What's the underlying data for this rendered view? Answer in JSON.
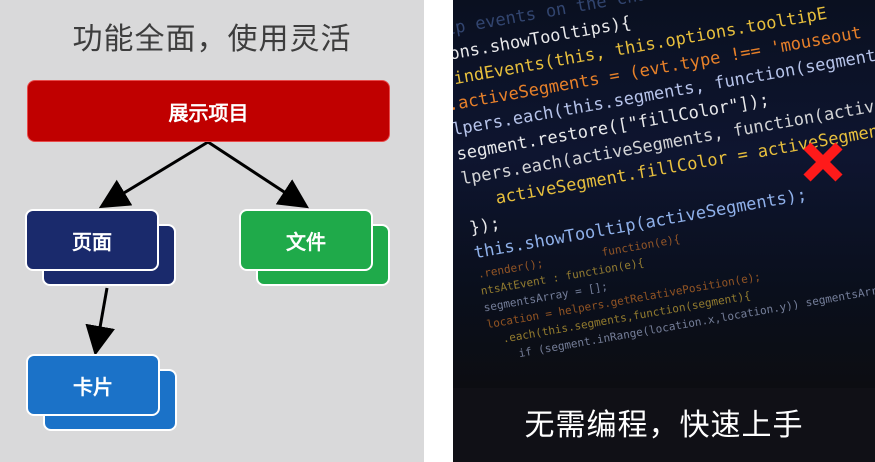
{
  "left_panel": {
    "title": "功能全面，使用灵活",
    "root_node": "展示项目",
    "page_node": "页面",
    "file_node": "文件",
    "card_node": "卡片"
  },
  "right_panel": {
    "caption": "无需编程，快速上手",
    "code_lines": [
      "tip events on the chart",
      "ions.showTooltips){",
      "bindEvents(this, this.options.tooltipE",
      ".activeSegments = (evt.type !== 'mouseout",
      "lpers.each(this.segments, function(segment",
      "segment.restore([\"fillColor\"]);",
      "lpers.each(activeSegments, function(activeSeg",
      "   activeSegment.fillColor = activeSegment.hig",
      "});",
      "this.showTooltip(activeSegments);",
      "",
      ".render();         function(e){",
      "ntsAtEvent : function(e){",
      "segmentsArray = [];",
      "location = helpers.getRelativePosition(e);",
      "  .each(this.segments,function(segment){",
      "    if (segment.inRange(location.x,location.y)) segmentsArray.p"
    ]
  },
  "colors": {
    "root": "#c00000",
    "page": "#1a2a6c",
    "file": "#1faa4a",
    "card": "#1b72c8",
    "cross": "#ff1a1a"
  }
}
